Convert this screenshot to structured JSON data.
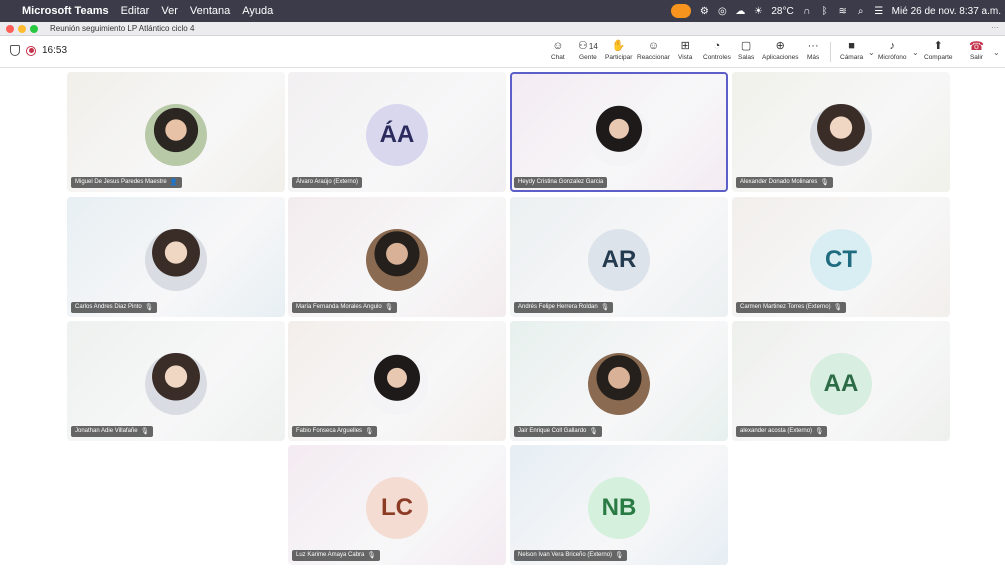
{
  "menubar": {
    "app_name": "Microsoft Teams",
    "menus": [
      "Editar",
      "Ver",
      "Ventana",
      "Ayuda"
    ],
    "weather": "28°C",
    "datetime": "Mié 26 de nov. 8:37 a.m."
  },
  "window": {
    "title": "Reunión seguimiento LP Atlántico ciclo 4"
  },
  "toolbar": {
    "timer": "16:53",
    "chat": "Chat",
    "people": "Gente",
    "people_count": "14",
    "raise": "Participar",
    "react": "Reaccionar",
    "view": "Vista",
    "controls": "Controles",
    "rooms": "Salas",
    "apps": "Aplicaciones",
    "more": "Más",
    "camera": "Cámara",
    "mic": "Micrófono",
    "share": "Comparte",
    "leave": "Salir"
  },
  "participants": [
    {
      "name": "Miguel De Jesus Paredes Maestre",
      "type": "photo",
      "photo_variant": "p3",
      "initials": "",
      "muted": false,
      "sharing": true,
      "avatar_bg": "",
      "initials_color": "",
      "tile_tint": "#f1efe9"
    },
    {
      "name": "Álvaro Araújo (Externo)",
      "type": "initials",
      "initials": "ÁA",
      "muted": false,
      "avatar_bg": "#d9d7ee",
      "initials_color": "#2b2b5e",
      "tile_tint": "#f2f0f1"
    },
    {
      "name": "Heydy Cristina Gonzalez Garcia",
      "type": "photo",
      "photo_variant": "p2",
      "initials": "",
      "muted": false,
      "active": true,
      "avatar_bg": "",
      "initials_color": "",
      "tile_tint": "#f3ebf2"
    },
    {
      "name": "Alexander Donado Molinares",
      "type": "photo",
      "photo_variant": "p1",
      "initials": "",
      "muted": true,
      "avatar_bg": "",
      "initials_color": "",
      "tile_tint": "#f0f1ea"
    },
    {
      "name": "Carlos Andres Diaz Pinto",
      "type": "photo",
      "photo_variant": "p1",
      "initials": "",
      "muted": true,
      "avatar_bg": "",
      "initials_color": "",
      "tile_tint": "#e7eff3"
    },
    {
      "name": "María Fernanda Morales Angulo",
      "type": "photo",
      "photo_variant": "p4",
      "initials": "",
      "muted": true,
      "avatar_bg": "",
      "initials_color": "",
      "tile_tint": "#f3ecee"
    },
    {
      "name": "Andrés Felipe Herrera Roldan",
      "type": "initials",
      "initials": "AR",
      "muted": true,
      "avatar_bg": "#dde3ea",
      "initials_color": "#243a4e",
      "tile_tint": "#ebf0f1"
    },
    {
      "name": "Carmen Martinez Torres (Externo)",
      "type": "initials",
      "initials": "CT",
      "muted": true,
      "avatar_bg": "#d8eef3",
      "initials_color": "#1f6c80",
      "tile_tint": "#f2efec"
    },
    {
      "name": "Jonathan Adie Villafañe",
      "type": "photo",
      "photo_variant": "p1",
      "initials": "",
      "muted": true,
      "avatar_bg": "",
      "initials_color": "",
      "tile_tint": "#eef1ef"
    },
    {
      "name": "Fabio Fonseca Arguelles",
      "type": "photo",
      "photo_variant": "p2",
      "initials": "",
      "muted": true,
      "avatar_bg": "",
      "initials_color": "",
      "tile_tint": "#f3eeea"
    },
    {
      "name": "Jair Enrique Coll Gallardo",
      "type": "photo",
      "photo_variant": "p4",
      "initials": "",
      "muted": true,
      "avatar_bg": "",
      "initials_color": "",
      "tile_tint": "#e7f0ee"
    },
    {
      "name": "alexander acosta (Externo)",
      "type": "initials",
      "initials": "AA",
      "muted": true,
      "avatar_bg": "#d7eee0",
      "initials_color": "#2c6b45",
      "tile_tint": "#eef0ed"
    },
    {
      "name": "Luz Karime Amaya Cabra",
      "type": "initials",
      "initials": "LC",
      "muted": true,
      "avatar_bg": "#f5dcd3",
      "initials_color": "#8c3b24",
      "tile_tint": "#f3ebf1"
    },
    {
      "name": "Nelson Ivan Vera Briceño (Externo)",
      "type": "initials",
      "initials": "NB",
      "muted": true,
      "avatar_bg": "#d5f0dc",
      "initials_color": "#2a7a44",
      "tile_tint": "#e6eef4"
    }
  ]
}
